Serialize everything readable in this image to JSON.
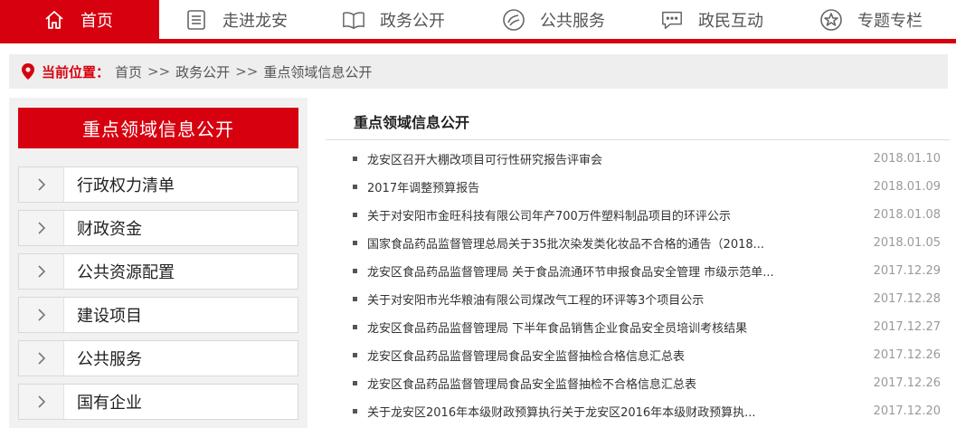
{
  "nav": {
    "items": [
      {
        "label": "首页",
        "icon": "home-icon",
        "active": true
      },
      {
        "label": "走进龙安",
        "icon": "document-list-icon"
      },
      {
        "label": "政务公开",
        "icon": "open-book-icon"
      },
      {
        "label": "公共服务",
        "icon": "service-circle-icon"
      },
      {
        "label": "政民互动",
        "icon": "chat-bubble-icon"
      },
      {
        "label": "专题专栏",
        "icon": "star-circle-icon"
      }
    ],
    "accent": "#d7000f"
  },
  "breadcrumb": {
    "label": "当前位置：",
    "items": [
      "首页",
      "政务公开",
      "重点领域信息公开"
    ],
    "separator": ">>"
  },
  "sidebar": {
    "title": "重点领域信息公开",
    "items": [
      {
        "label": "行政权力清单"
      },
      {
        "label": "财政资金"
      },
      {
        "label": "公共资源配置"
      },
      {
        "label": "建设项目"
      },
      {
        "label": "公共服务"
      },
      {
        "label": "国有企业"
      }
    ]
  },
  "main": {
    "title": "重点领域信息公开",
    "articles": [
      {
        "title": "龙安区召开大棚改项目可行性研究报告评审会",
        "date": "2018.01.10"
      },
      {
        "title": "2017年调整预算报告",
        "date": "2018.01.09"
      },
      {
        "title": "关于对安阳市金旺科技有限公司年产700万件塑料制品项目的环评公示",
        "date": "2018.01.08"
      },
      {
        "title": "国家食品药品监督管理总局关于35批次染发类化妆品不合格的通告（2018...",
        "date": "2018.01.05"
      },
      {
        "title": "龙安区食品药品监督管理局 关于食品流通环节申报食品安全管理 市级示范单...",
        "date": "2017.12.29"
      },
      {
        "title": "关于对安阳市光华粮油有限公司煤改气工程的环评等3个项目公示",
        "date": "2017.12.28"
      },
      {
        "title": "龙安区食品药品监督管理局 下半年食品销售企业食品安全员培训考核结果",
        "date": "2017.12.27"
      },
      {
        "title": "龙安区食品药品监督管理局食品安全监督抽检合格信息汇总表",
        "date": "2017.12.26"
      },
      {
        "title": "龙安区食品药品监督管理局食品安全监督抽检不合格信息汇总表",
        "date": "2017.12.26"
      },
      {
        "title": "关于龙安区2016年本级财政预算执行关于龙安区2016年本级财政预算执...",
        "date": "2017.12.20"
      }
    ]
  }
}
